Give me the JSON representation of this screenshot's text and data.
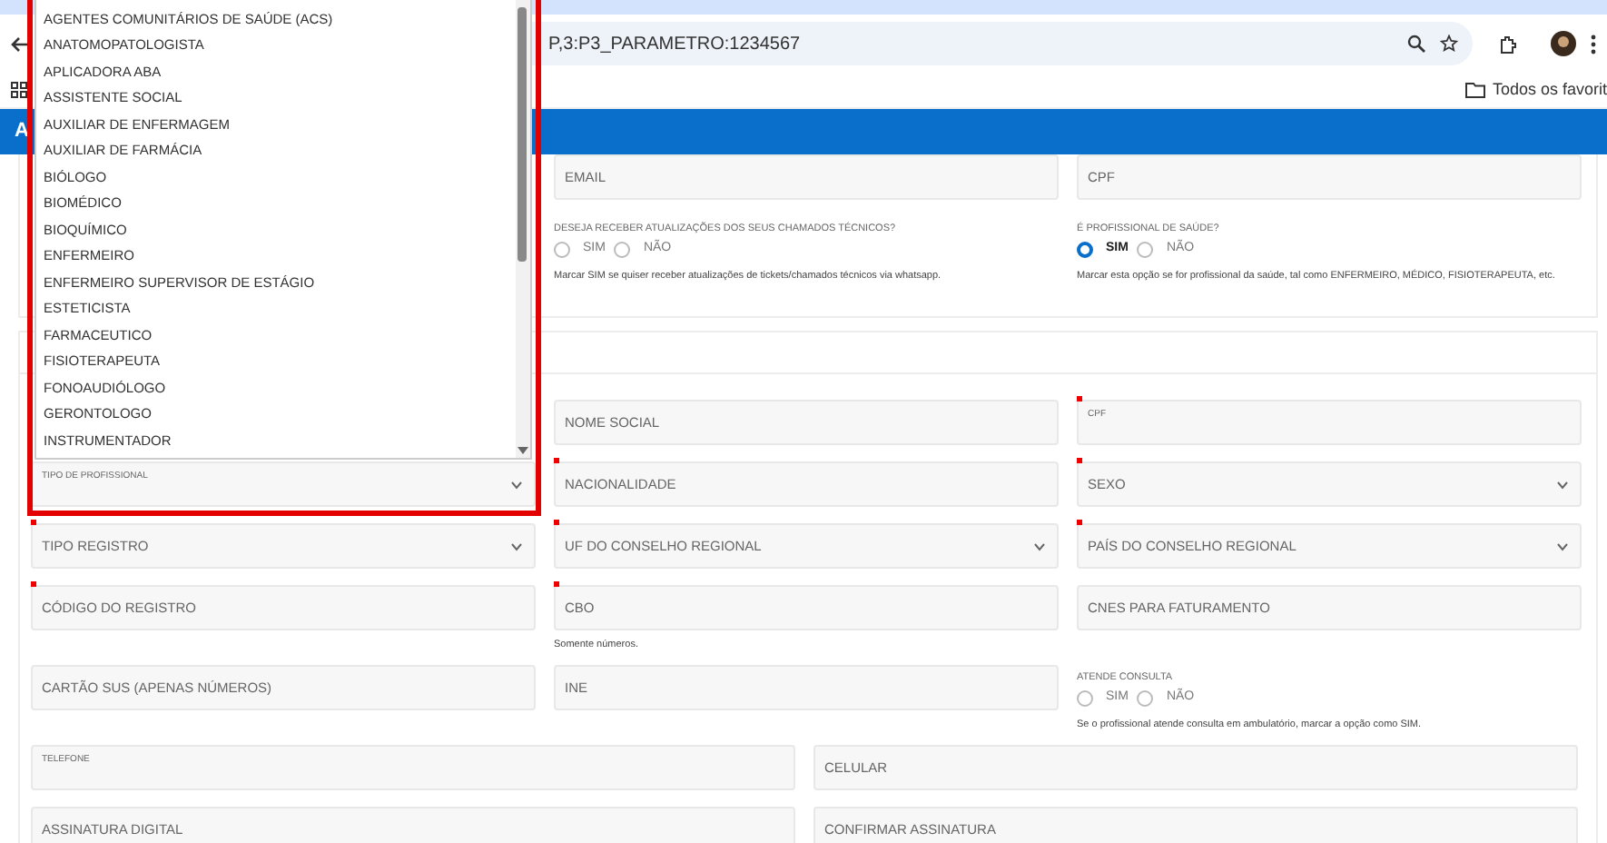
{
  "browser": {
    "url": "P,3:P3_PARAMETRO:1234567",
    "bookmarks_folder": "Todos os favorit"
  },
  "app_bar": {
    "title": "A"
  },
  "contact_card": {
    "fields": [
      {
        "kind": "input",
        "label": "EMAIL",
        "required": false,
        "floating": false
      },
      {
        "kind": "input",
        "label": "CPF",
        "required": false,
        "floating": false
      }
    ],
    "radio_groups": [
      {
        "label": "DESEJA RECEBER ATUALIZAÇÕES DOS SEUS CHAMADOS TÉCNICOS?",
        "options": [
          {
            "label": "SIM",
            "selected": false
          },
          {
            "label": "NÃO",
            "selected": false
          }
        ],
        "help": "Marcar SIM se quiser receber atualizações de tickets/chamados técnicos via whatsapp."
      },
      {
        "label": "É PROFISSIONAL DE SAÚDE?",
        "options": [
          {
            "label": "SIM",
            "selected": true
          },
          {
            "label": "NÃO",
            "selected": false
          }
        ],
        "help": "Marcar esta opção se for profissional da saúde, tal como ENFERMEIRO, MÉDICO, FISIOTERAPEUTA, etc."
      }
    ]
  },
  "professional_card": {
    "rows": [
      [
        null,
        {
          "kind": "input",
          "label": "NOME SOCIAL",
          "required": false,
          "floating": false
        },
        {
          "kind": "input",
          "label": "CPF",
          "required": true,
          "floating": true
        }
      ],
      [
        {
          "kind": "select",
          "label": "TIPO DE PROFISSIONAL",
          "required": false,
          "floating": true
        },
        {
          "kind": "input",
          "label": "NACIONALIDADE",
          "required": true,
          "floating": false
        },
        {
          "kind": "select",
          "label": "SEXO",
          "required": true,
          "floating": false
        }
      ],
      [
        {
          "kind": "select",
          "label": "TIPO REGISTRO",
          "required": true,
          "floating": false
        },
        {
          "kind": "select",
          "label": "UF DO CONSELHO REGIONAL",
          "required": true,
          "floating": false
        },
        {
          "kind": "select",
          "label": "PAÍS DO CONSELHO REGIONAL",
          "required": true,
          "floating": false
        }
      ],
      [
        {
          "kind": "input",
          "label": "CÓDIGO DO REGISTRO",
          "required": true,
          "floating": false
        },
        {
          "kind": "input",
          "label": "CBO",
          "required": true,
          "floating": false,
          "help": "Somente números."
        },
        {
          "kind": "input",
          "label": "CNES PARA FATURAMENTO",
          "required": false,
          "floating": false
        }
      ],
      [
        {
          "kind": "input",
          "label": "CARTÃO SUS (APENAS NÚMEROS)",
          "required": false,
          "floating": false
        },
        {
          "kind": "input",
          "label": "INE",
          "required": false,
          "floating": false
        },
        {
          "kind": "radio",
          "label": "ATENDE CONSULTA",
          "options": [
            {
              "label": "SIM",
              "selected": false
            },
            {
              "label": "NÃO",
              "selected": false
            }
          ],
          "help": "Se o profissional atende consulta em ambulatório, marcar a opção como SIM."
        }
      ],
      [
        {
          "kind": "input",
          "label": "TELEFONE",
          "required": false,
          "floating": true
        },
        {
          "kind": "input",
          "label": "CELULAR",
          "required": false,
          "floating": false
        }
      ],
      [
        {
          "kind": "input",
          "label": "ASSINATURA DIGITAL",
          "required": false,
          "floating": false
        },
        {
          "kind": "input",
          "label": "CONFIRMAR ASSINATURA",
          "required": false,
          "floating": false
        }
      ]
    ]
  },
  "dropdown": {
    "options": [
      {
        "label": "AGENTES COMUNITÁRIOS DE SAÚDE (ACS)",
        "selected": false
      },
      {
        "label": "ANATOMOPATOLOGISTA",
        "selected": false
      },
      {
        "label": "APLICADORA ABA",
        "selected": false
      },
      {
        "label": "ASSISTENTE SOCIAL",
        "selected": false
      },
      {
        "label": "AUXILIAR DE ENFERMAGEM",
        "selected": false
      },
      {
        "label": "AUXILIAR DE FARMÁCIA",
        "selected": false
      },
      {
        "label": "BIÓLOGO",
        "selected": false
      },
      {
        "label": "BIOMÉDICO",
        "selected": false
      },
      {
        "label": "BIOQUÍMICO",
        "selected": false
      },
      {
        "label": "ENFERMEIRO",
        "selected": false
      },
      {
        "label": "ENFERMEIRO SUPERVISOR DE ESTÁGIO",
        "selected": false
      },
      {
        "label": "ESTETICISTA",
        "selected": false
      },
      {
        "label": "FARMACEUTICO",
        "selected": false
      },
      {
        "label": "FISIOTERAPEUTA",
        "selected": false
      },
      {
        "label": "FONOAUDIÓLOGO",
        "selected": false
      },
      {
        "label": "GERONTOLOGO",
        "selected": false
      },
      {
        "label": "INSTRUMENTADOR",
        "selected": false
      }
    ]
  }
}
